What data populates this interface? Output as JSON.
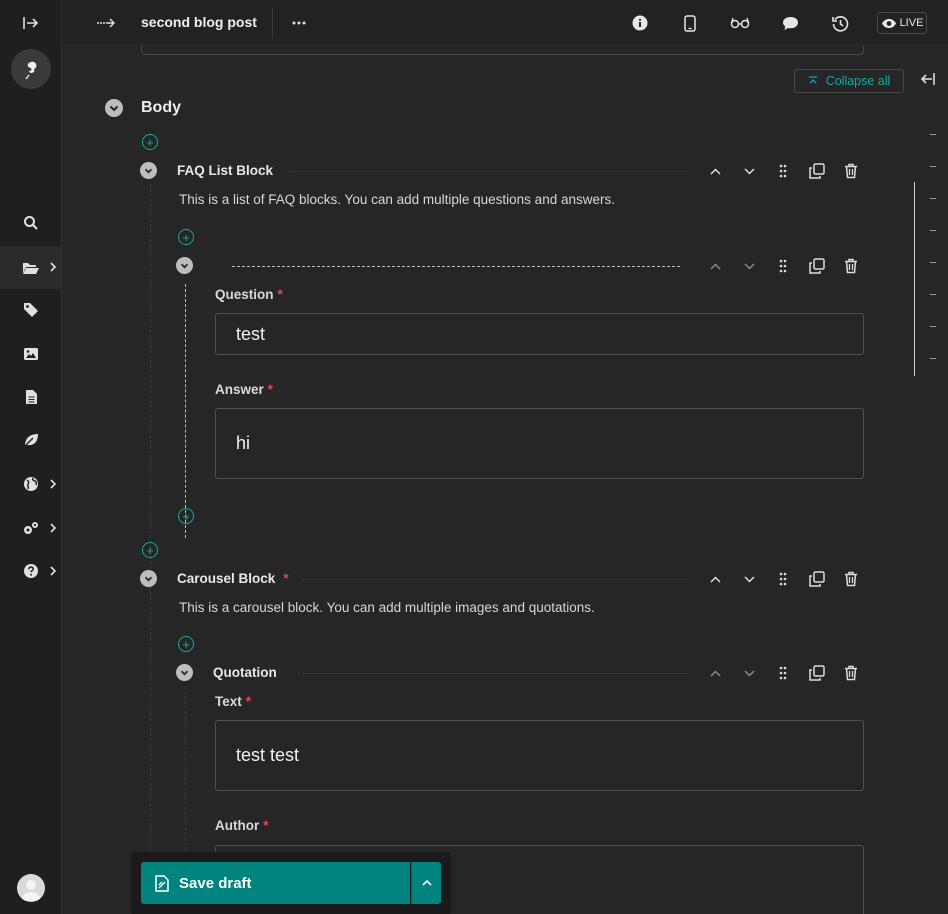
{
  "topbar": {
    "breadcrumb_icon": "breadcrumb-arrow-icon",
    "title": "second blog post",
    "more_icon": "ellipsis-icon",
    "tools": [
      "info-icon",
      "mobile-icon",
      "glasses-icon",
      "comment-icon",
      "history-icon"
    ],
    "live_label": "LIVE"
  },
  "sidebar": {
    "items": [
      {
        "icon": "search-icon",
        "has_chevron": false
      },
      {
        "icon": "folder-open-icon",
        "has_chevron": true,
        "active": true
      },
      {
        "icon": "tag-icon",
        "has_chevron": false
      },
      {
        "icon": "image-icon",
        "has_chevron": false
      },
      {
        "icon": "document-icon",
        "has_chevron": false
      },
      {
        "icon": "leaf-icon",
        "has_chevron": false
      },
      {
        "icon": "globe-icon",
        "has_chevron": true
      },
      {
        "icon": "settings-icon",
        "has_chevron": true
      },
      {
        "icon": "help-icon",
        "has_chevron": true
      }
    ]
  },
  "editor": {
    "collapse_all_label": "Collapse all",
    "body_section": {
      "title": "Body",
      "blocks": [
        {
          "title": "FAQ List Block",
          "required": false,
          "description": "This is a list of FAQ blocks. You can add multiple questions and answers.",
          "item": {
            "title": "",
            "fields": [
              {
                "label": "Question",
                "required": true,
                "value": "test"
              },
              {
                "label": "Answer",
                "required": true,
                "value": "hi"
              }
            ]
          }
        },
        {
          "title": "Carousel Block",
          "required": true,
          "description": "This is a carousel block. You can add multiple images and quotations.",
          "item": {
            "title": "Quotation",
            "fields": [
              {
                "label": "Text",
                "required": true,
                "value": "test test"
              },
              {
                "label": "Author",
                "required": true,
                "value": ""
              }
            ]
          }
        }
      ]
    }
  },
  "save": {
    "label": "Save draft"
  },
  "colors": {
    "accent": "#018380",
    "accent_text": "#14a89e",
    "required": "#e5484d",
    "background": "#262626"
  }
}
